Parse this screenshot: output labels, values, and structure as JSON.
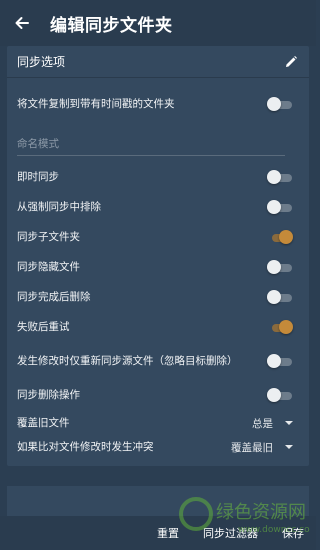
{
  "appbar": {
    "title": "编辑同步文件夹"
  },
  "card": {
    "title": "同步选项",
    "rows": [
      {
        "label": "将文件复制到带有时间戳的文件夹",
        "on": false
      },
      {
        "label": "即时同步",
        "on": false
      },
      {
        "label": "从强制同步中排除",
        "on": false
      },
      {
        "label": "同步子文件夹",
        "on": true
      },
      {
        "label": "同步隐藏文件",
        "on": false
      },
      {
        "label": "同步完成后删除",
        "on": false
      },
      {
        "label": "失败后重试",
        "on": true
      },
      {
        "label": "发生修改时仅重新同步源文件（忽略目标删除）",
        "on": false
      },
      {
        "label": "同步删除操作",
        "on": false
      }
    ],
    "naming_mode_label": "命名模式",
    "overwrite": {
      "label": "覆盖旧文件",
      "value": "总是"
    },
    "conflict": {
      "label": "如果比对文件修改时发生冲突",
      "value": "覆盖最旧"
    }
  },
  "footer": {
    "reset_label": "重置",
    "filters_label": "同步过滤器",
    "save_label": "保存"
  },
  "watermark": {
    "text": "绿色资源网",
    "url": "downcc.com"
  },
  "colors": {
    "accent": "#c48a3a",
    "background": "#2b3e52",
    "card": "#34495f"
  }
}
